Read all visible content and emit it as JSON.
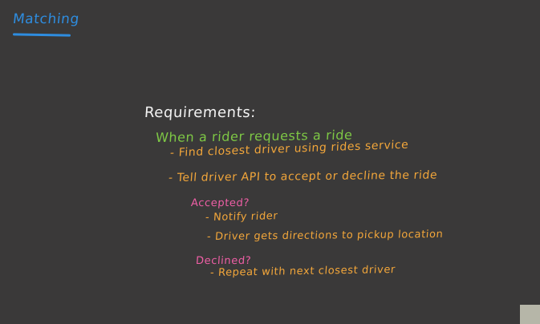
{
  "title": "Matching",
  "requirements_label": "Requirements:",
  "notes": {
    "when_line": "When a rider requests a ride",
    "find_line": "- Find closest driver using rides service",
    "tell_line": "- Tell driver API to accept or decline the ride",
    "accepted_label": "Accepted?",
    "accepted_items": [
      "- Notify rider",
      "- Driver gets directions to pickup location"
    ],
    "declined_label": "Declined?",
    "declined_items": [
      "- Repeat with next closest driver"
    ]
  },
  "colors": {
    "background": "#3a3939",
    "title": "#2e8de0",
    "requirements": "#f2f2f2",
    "when": "#7ec845",
    "items": "#f2a63a",
    "conditions": "#f05fa6"
  }
}
